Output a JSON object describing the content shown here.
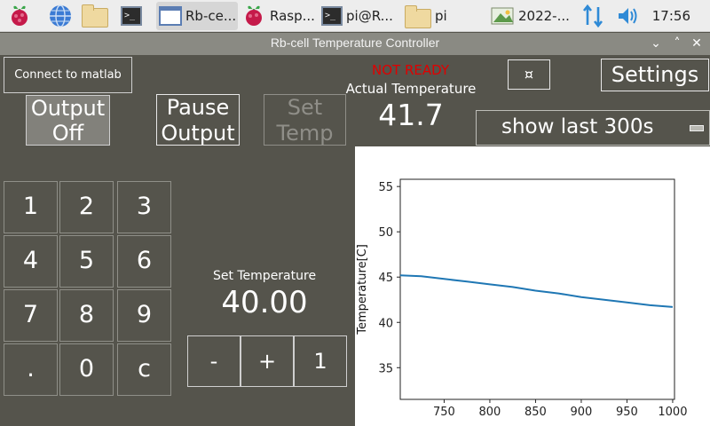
{
  "taskbar": {
    "tasks": [
      {
        "label": "Rb-ce..."
      },
      {
        "label": "Rasp..."
      },
      {
        "label": "pi@R..."
      },
      {
        "label": "pi"
      },
      {
        "label": "2022-..."
      }
    ],
    "terminal_glyph": ">_",
    "clock": "17:56"
  },
  "window": {
    "title": "Rb-cell Temperature Controller",
    "min_glyph": "⌄",
    "max_glyph": "˄",
    "close_glyph": "✕"
  },
  "controls": {
    "connect_label": "Connect to matlab",
    "status_text": "NOT READY",
    "status_color": "#e00000",
    "special_button_glyph": "¤",
    "settings_label": "Settings",
    "output_button": {
      "line1": "Output",
      "line2": "Off"
    },
    "pause_button": {
      "line1": "Pause",
      "line2": "Output"
    },
    "set_temp_button": {
      "line1": "Set",
      "line2": "Temp"
    },
    "actual_temp_label": "Actual Temperature",
    "actual_temp_value": "41.7",
    "window_select": "show last 300s",
    "keypad": [
      "1",
      "2",
      "3",
      "4",
      "5",
      "6",
      "7",
      "8",
      "9",
      ".",
      "0",
      "c"
    ],
    "set_temp_label": "Set Temperature",
    "set_temp_value": "40.00",
    "step_buttons": [
      "-",
      "+",
      "1"
    ]
  },
  "chart_data": {
    "type": "line",
    "title": "",
    "xlabel": "",
    "ylabel": "Temperature[C]",
    "xlim": [
      702,
      1002
    ],
    "ylim": [
      31.5,
      55.8
    ],
    "xticks": [
      "750",
      "800",
      "850",
      "900",
      "950",
      "1000"
    ],
    "yticks": [
      "35",
      "40",
      "45",
      "50",
      "55"
    ],
    "grid": false,
    "color": "#1f77b4",
    "series": [
      {
        "x": [
          702,
          725,
          750,
          775,
          800,
          825,
          850,
          875,
          900,
          925,
          950,
          975,
          1000
        ],
        "values": [
          45.2,
          45.1,
          44.8,
          44.5,
          44.2,
          43.9,
          43.5,
          43.2,
          42.8,
          42.5,
          42.2,
          41.9,
          41.7
        ]
      }
    ]
  }
}
